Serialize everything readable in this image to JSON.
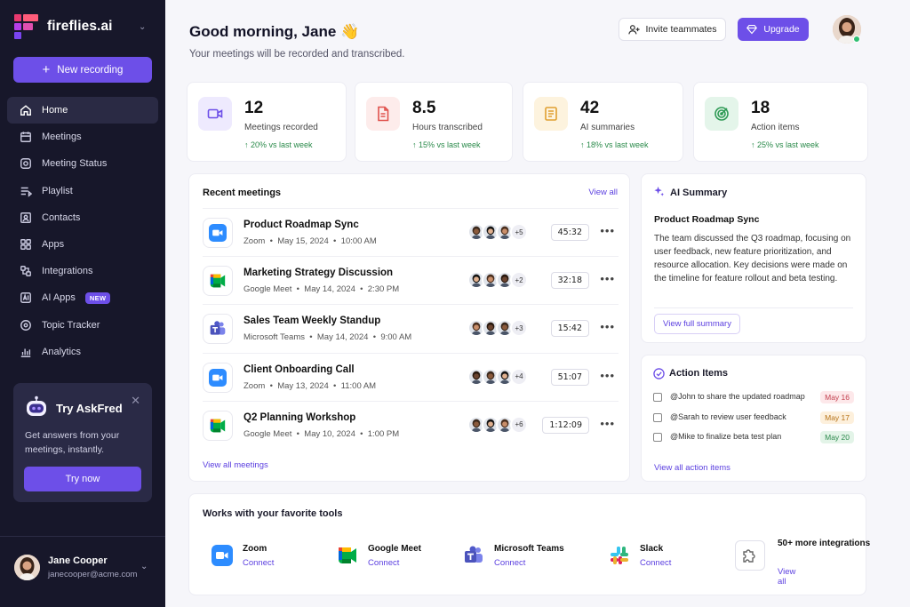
{
  "brand": {
    "name": "fireflies.ai"
  },
  "sidebar": {
    "new_recording": "New recording",
    "items": [
      {
        "label": "Home",
        "icon": "home-icon",
        "active": true
      },
      {
        "label": "Meetings",
        "icon": "calendar-icon"
      },
      {
        "label": "Meeting Status",
        "icon": "status-icon"
      },
      {
        "label": "Playlist",
        "icon": "playlist-icon"
      },
      {
        "label": "Contacts",
        "icon": "contacts-icon"
      },
      {
        "label": "Apps",
        "icon": "apps-icon"
      },
      {
        "label": "Integrations",
        "icon": "integrations-icon"
      },
      {
        "label": "AI Apps",
        "icon": "ai-apps-icon",
        "badge": "NEW"
      },
      {
        "label": "Topic Tracker",
        "icon": "topic-tracker-icon"
      },
      {
        "label": "Analytics",
        "icon": "analytics-icon"
      }
    ],
    "askfred": {
      "title": "Try AskFred",
      "description": "Get answers from your meetings, instantly.",
      "button": "Try now"
    },
    "user": {
      "name": "Jane Cooper",
      "email": "janecooper@acme.com"
    }
  },
  "header": {
    "greeting": "Good morning, Jane 👋",
    "subtitle": "Your meetings will be recorded and transcribed.",
    "invite": "Invite teammates",
    "upgrade": "Upgrade"
  },
  "stats": [
    {
      "value": "12",
      "label": "Meetings recorded",
      "trend": "↑ 20% vs last week",
      "icon": "video-icon"
    },
    {
      "value": "8.5",
      "label": "Hours transcribed",
      "trend": "↑ 15% vs last week",
      "icon": "document-icon"
    },
    {
      "value": "42",
      "label": "AI summaries",
      "trend": "↑ 18% vs last week",
      "icon": "notes-icon"
    },
    {
      "value": "18",
      "label": "Action items",
      "trend": "↑ 25% vs last week",
      "icon": "target-icon"
    }
  ],
  "recent": {
    "title": "Recent meetings",
    "view_all": "View all",
    "view_all_meetings": "View all meetings",
    "meetings": [
      {
        "title": "Product Roadmap Sync",
        "platform": "Zoom",
        "date": "May 15, 2024",
        "time": "10:00 AM",
        "extra": "+5",
        "duration": "45:32",
        "app": "zoom"
      },
      {
        "title": "Marketing Strategy Discussion",
        "platform": "Google Meet",
        "date": "May 14, 2024",
        "time": "2:30 PM",
        "extra": "+2",
        "duration": "32:18",
        "app": "meet"
      },
      {
        "title": "Sales Team Weekly Standup",
        "platform": "Microsoft Teams",
        "date": "May 14, 2024",
        "time": "9:00 AM",
        "extra": "+3",
        "duration": "15:42",
        "app": "teams"
      },
      {
        "title": "Client Onboarding Call",
        "platform": "Zoom",
        "date": "May 13, 2024",
        "time": "11:00 AM",
        "extra": "+4",
        "duration": "51:07",
        "app": "zoom"
      },
      {
        "title": "Q2 Planning Workshop",
        "platform": "Google Meet",
        "date": "May 10, 2024",
        "time": "1:00 PM",
        "extra": "+6",
        "duration": "1:12:09",
        "app": "meet"
      }
    ]
  },
  "summary": {
    "title": "AI Summary",
    "meeting": "Product Roadmap Sync",
    "text": "The team discussed the Q3 roadmap, focusing on user feedback, new feature prioritization, and resource allocation. Key decisions were made on the timeline for feature rollout and beta testing.",
    "button": "View full summary"
  },
  "actions": {
    "title": "Action Items",
    "items": [
      {
        "text": "@John to share the updated roadmap",
        "date": "May 16",
        "bg": "#fde8ea",
        "fg": "#c2414f"
      },
      {
        "text": "@Sarah to review user feedback",
        "date": "May 17",
        "bg": "#fdf0dc",
        "fg": "#b7741a"
      },
      {
        "text": "@Mike to finalize beta test plan",
        "date": "May 20",
        "bg": "#e3f4e8",
        "fg": "#2e8a4d"
      }
    ],
    "link": "View all action items"
  },
  "tools": {
    "title": "Works with your favorite tools",
    "items": [
      {
        "name": "Zoom",
        "action": "Connect",
        "icon": "zoom-icon"
      },
      {
        "name": "Google Meet",
        "action": "Connect",
        "icon": "google-meet-icon"
      },
      {
        "name": "Microsoft Teams",
        "action": "Connect",
        "icon": "teams-icon"
      },
      {
        "name": "Slack",
        "action": "Connect",
        "icon": "slack-icon"
      },
      {
        "name": "50+ more integrations",
        "action": "View all",
        "icon": "puzzle-icon"
      }
    ]
  },
  "colors": {
    "accent": "#6d4fe8",
    "sidebar": "#17172a",
    "link": "#5b3fe0"
  }
}
